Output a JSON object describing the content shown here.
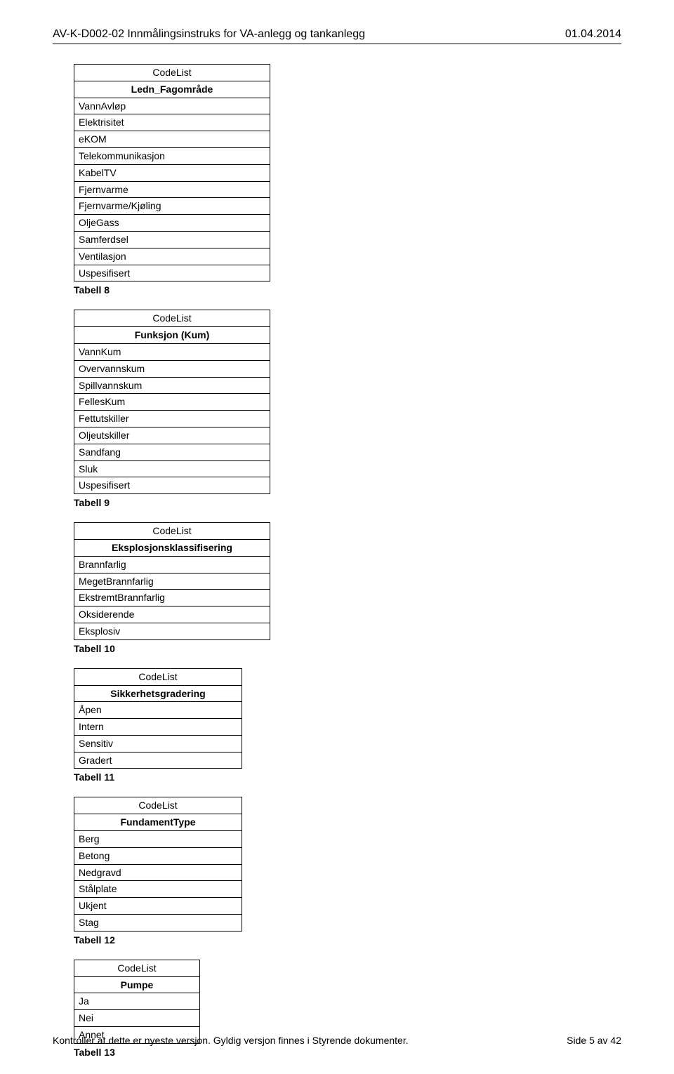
{
  "header": {
    "left": "AV-K-D002-02  Innmålingsinstruks for VA-anlegg og tankanlegg",
    "right": "01.04.2014"
  },
  "tables": [
    {
      "width": "default",
      "heading_sup": "CodeList",
      "heading_main": "Ledn_Fagområde",
      "rows": [
        "VannAvløp",
        "Elektrisitet",
        "eKOM",
        "Telekommunikasjon",
        "KabelTV",
        "Fjernvarme",
        "Fjernvarme/Kjøling",
        "OljeGass",
        "Samferdsel",
        "Ventilasjon",
        "Uspesifisert"
      ],
      "caption": "Tabell 8"
    },
    {
      "width": "default",
      "heading_sup": "CodeList",
      "heading_main": "Funksjon (Kum)",
      "rows": [
        "VannKum",
        "Overvannskum",
        "Spillvannskum",
        "FellesKum",
        "Fettutskiller",
        "Oljeutskiller",
        "Sandfang",
        "Sluk",
        "Uspesifisert"
      ],
      "caption": "Tabell 9"
    },
    {
      "width": "default",
      "heading_sup": "CodeList",
      "heading_main": "Eksplosjonsklassifisering",
      "rows": [
        "Brannfarlig",
        "MegetBrannfarlig",
        "EkstremtBrannfarlig",
        "Oksiderende",
        "Eksplosiv"
      ],
      "caption": "Tabell 10"
    },
    {
      "width": "med",
      "heading_sup": "CodeList",
      "heading_main": "Sikkerhetsgradering",
      "rows": [
        "Åpen",
        "Intern",
        "Sensitiv",
        "Gradert"
      ],
      "caption": "Tabell 11"
    },
    {
      "width": "med",
      "heading_sup": "CodeList",
      "heading_main": "FundamentType",
      "rows": [
        "Berg",
        "Betong",
        "Nedgravd",
        "Stålplate",
        "Ukjent",
        "Stag"
      ],
      "caption": "Tabell 12"
    },
    {
      "width": "narrow",
      "heading_sup": "CodeList",
      "heading_main": "Pumpe",
      "rows": [
        "Ja",
        "Nei",
        "Annet"
      ],
      "caption": "Tabell 13"
    }
  ],
  "footer": {
    "left": "Kontroller at dette er nyeste versjon. Gyldig versjon finnes i Styrende dokumenter.",
    "right": "Side 5 av 42"
  }
}
